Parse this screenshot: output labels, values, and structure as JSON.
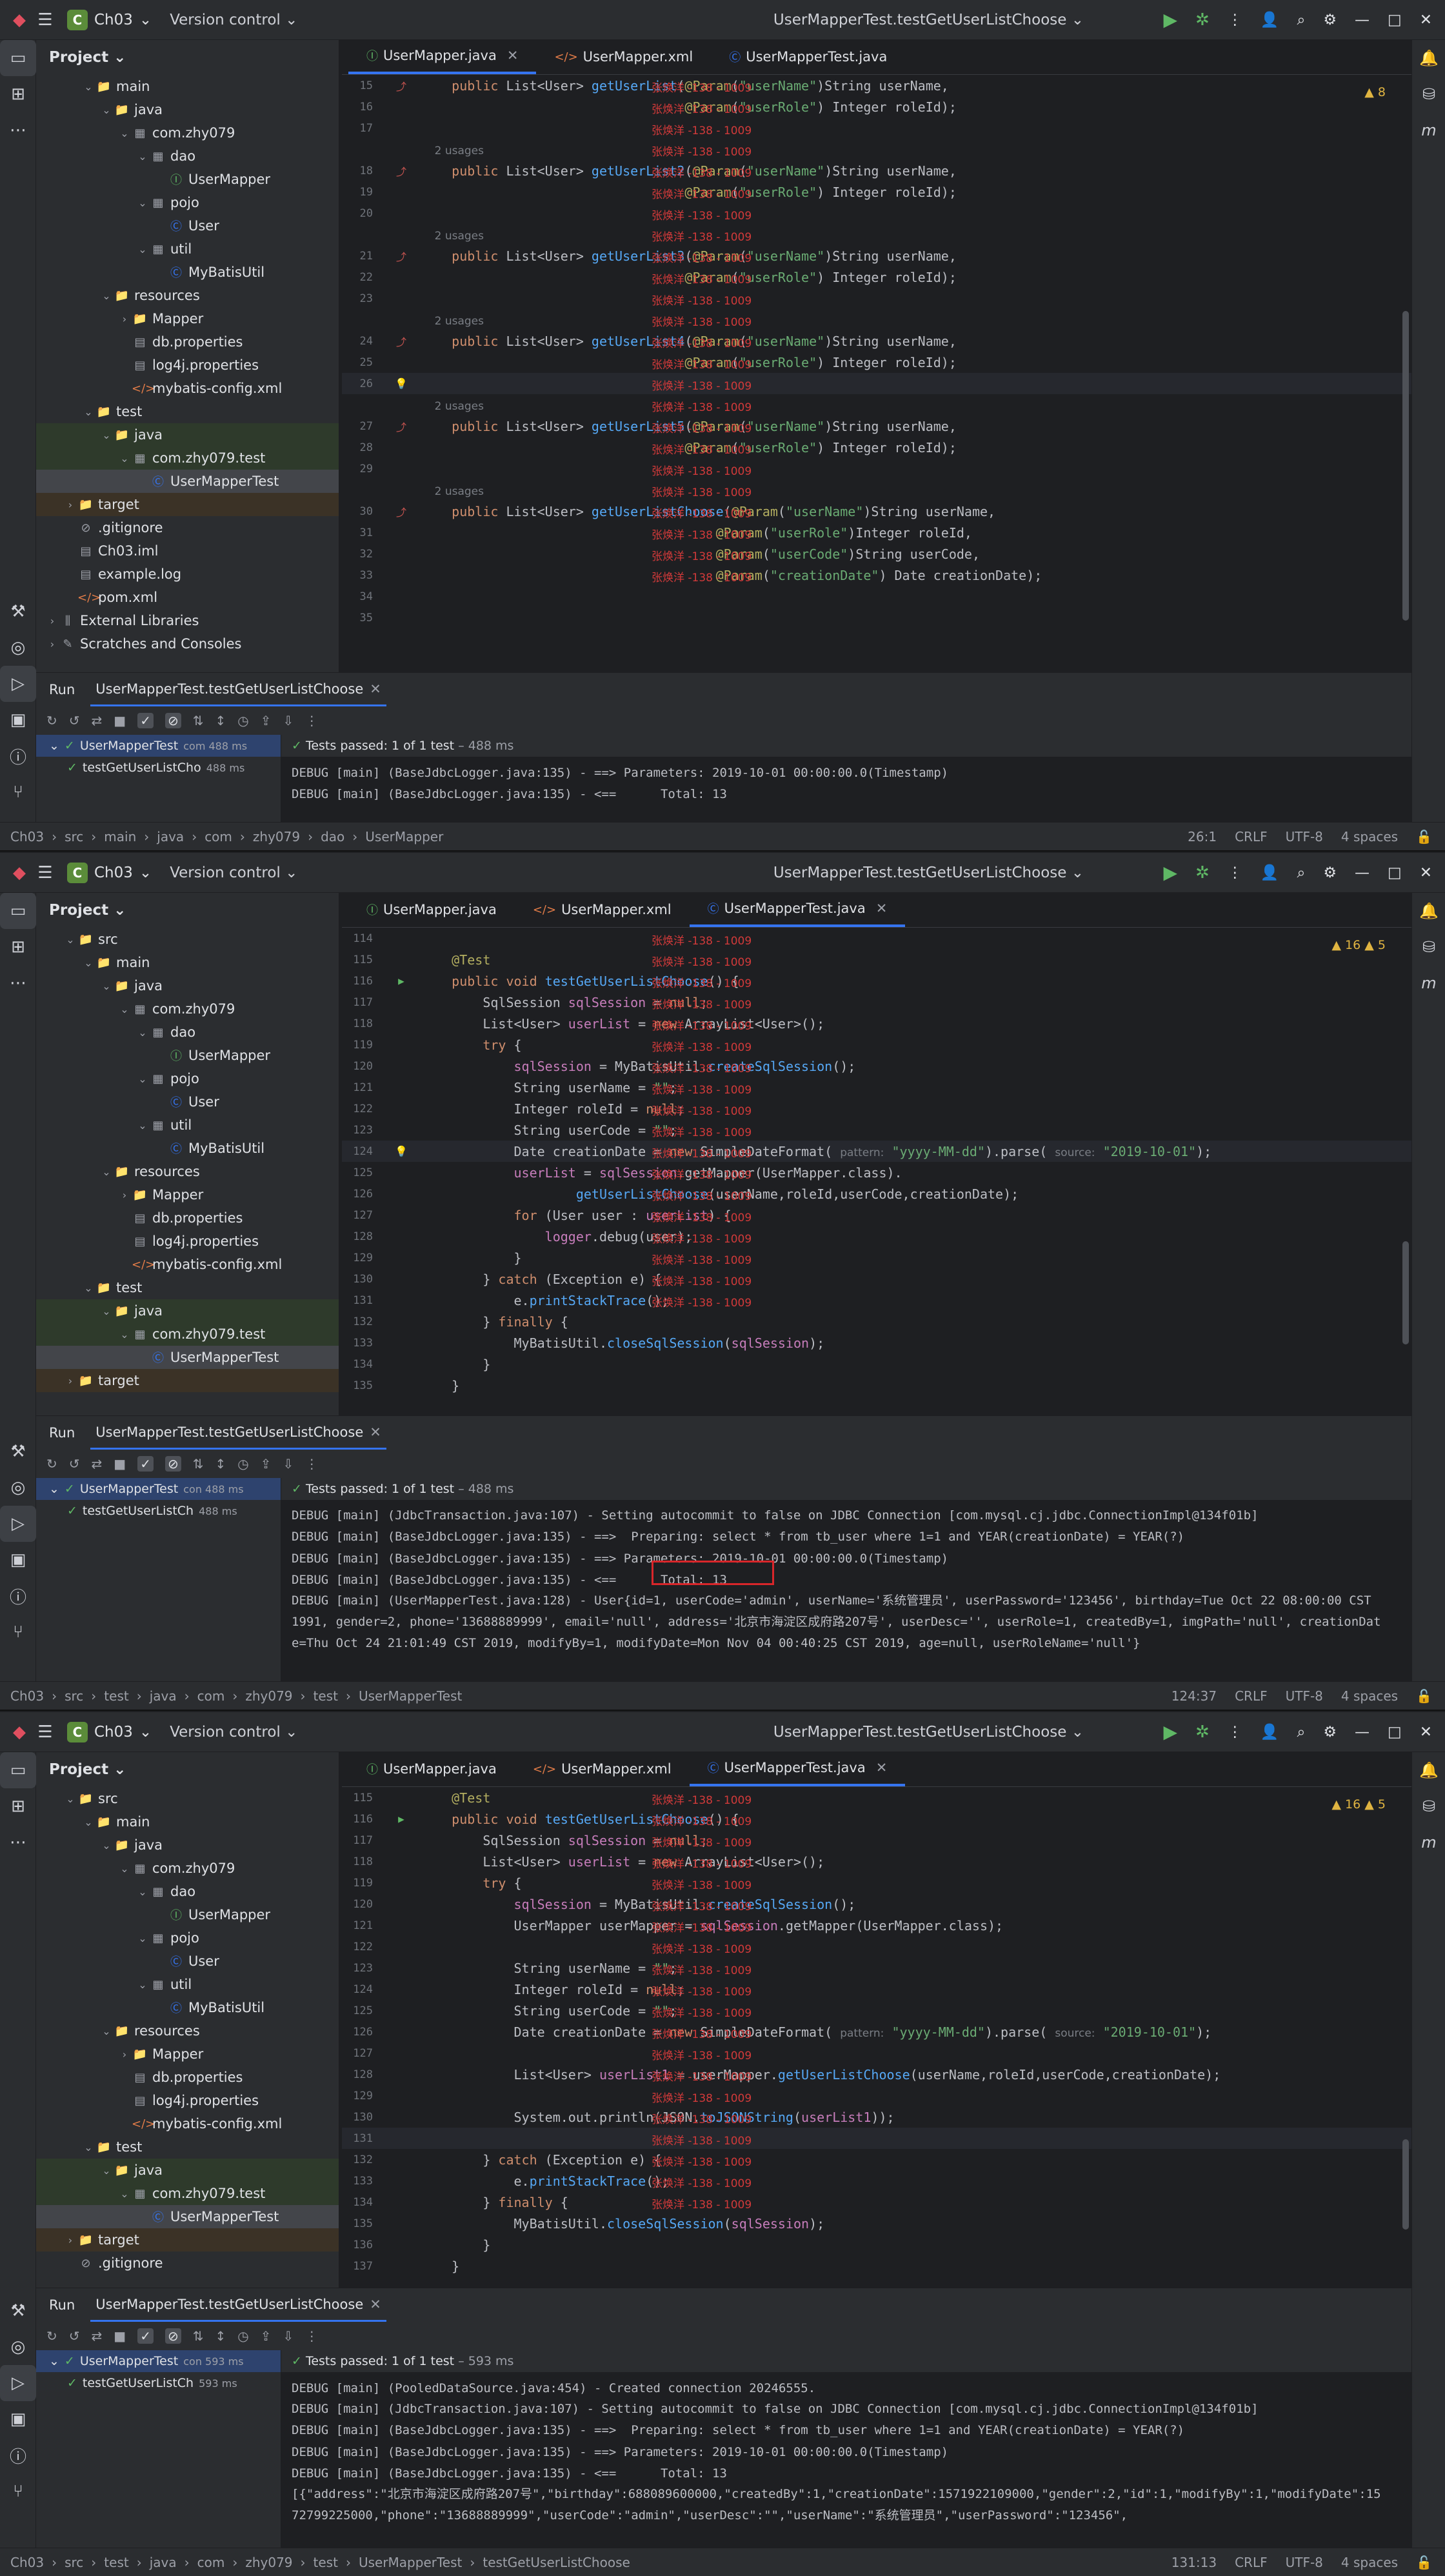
{
  "common": {
    "project_badge": "C",
    "project_name": "Ch03",
    "vcs": "Version control",
    "project_tool": "Project",
    "run_label": "Run",
    "tests_passed_label": "Tests passed:",
    "tests_passed_count": "1 of 1 test",
    "watermark": "张焕洋 -138 - 1009",
    "ide_icon": "ide-logo-icon",
    "colors": {
      "accent": "#3574f0",
      "green": "#5fb865",
      "keyword": "#cf8e6d",
      "function": "#56a8f5",
      "string": "#6aab73",
      "annotation": "#b3ae60"
    }
  },
  "p1": {
    "config": "UserMapperTest.testGetUserListChoose",
    "tabs": [
      {
        "label": "UserMapper.java"
      },
      {
        "label": "UserMapper.xml"
      },
      {
        "label": "UserMapperTest.java"
      }
    ],
    "inspection": "▲ 8",
    "tree": [
      "main",
      "java",
      "com.zhy079",
      "dao",
      "UserMapper",
      "pojo",
      "User",
      "util",
      "MyBatisUtil",
      "resources",
      "Mapper",
      "db.properties",
      "log4j.properties",
      "mybatis-config.xml",
      "test",
      "java",
      "com.zhy079.test",
      "UserMapperTest",
      "target",
      ".gitignore",
      "Ch03.iml",
      "example.log",
      "pom.xml",
      "External Libraries",
      "Scratches and Consoles"
    ],
    "lines": [
      {
        "n": "15",
        "c": "    public List<User> getUserList(@Param(\"userName\")String userName,"
      },
      {
        "n": "16",
        "c": "                                  @Param(\"userRole\") Integer roleId);"
      },
      {
        "n": "17",
        "c": ""
      },
      {
        "n": "",
        "c": "    2 usages"
      },
      {
        "n": "18",
        "c": "    public List<User> getUserList2(@Param(\"userName\")String userName,"
      },
      {
        "n": "19",
        "c": "                                  @Param(\"userRole\") Integer roleId);"
      },
      {
        "n": "20",
        "c": ""
      },
      {
        "n": "",
        "c": "    2 usages"
      },
      {
        "n": "21",
        "c": "    public List<User> getUserList3(@Param(\"userName\")String userName,"
      },
      {
        "n": "22",
        "c": "                                  @Param(\"userRole\") Integer roleId);"
      },
      {
        "n": "23",
        "c": ""
      },
      {
        "n": "",
        "c": "    2 usages"
      },
      {
        "n": "24",
        "c": "    public List<User> getUserList4(@Param(\"userName\")String userName,"
      },
      {
        "n": "25",
        "c": "                                  @Param(\"userRole\") Integer roleId);"
      },
      {
        "n": "26",
        "c": ""
      },
      {
        "n": "",
        "c": "    2 usages"
      },
      {
        "n": "27",
        "c": "    public List<User> getUserList5(@Param(\"userName\")String userName,"
      },
      {
        "n": "28",
        "c": "                                  @Param(\"userRole\") Integer roleId);"
      },
      {
        "n": "29",
        "c": ""
      },
      {
        "n": "",
        "c": "    2 usages"
      },
      {
        "n": "30",
        "c": "    public List<User> getUserListChoose(@Param(\"userName\")String userName,"
      },
      {
        "n": "31",
        "c": "                                      @Param(\"userRole\")Integer roleId,"
      },
      {
        "n": "32",
        "c": "                                      @Param(\"userCode\")String userCode,"
      },
      {
        "n": "33",
        "c": "                                      @Param(\"creationDate\") Date creationDate);"
      },
      {
        "n": "34",
        "c": ""
      },
      {
        "n": "35",
        "c": ""
      }
    ],
    "run_tab": "UserMapperTest.testGetUserListChoose",
    "run_tree": [
      {
        "label": "UserMapperTest",
        "meta": "com 488 ms"
      },
      {
        "label": "testGetUserListCho",
        "meta": "488 ms"
      }
    ],
    "duration": "488 ms",
    "console": [
      "DEBUG [main] (BaseJdbcLogger.java:135) - ==> Parameters: 2019-10-01 00:00:00.0(Timestamp)",
      "DEBUG [main] (BaseJdbcLogger.java:135) - <==      Total: 13"
    ],
    "breadcrumb": [
      "Ch03",
      "src",
      "main",
      "java",
      "com",
      "zhy079",
      "dao",
      "UserMapper"
    ],
    "status": [
      "26:1",
      "CRLF",
      "UTF-8",
      "4 spaces"
    ]
  },
  "p2": {
    "config": "UserMapperTest.testGetUserListChoose",
    "tabs": [
      {
        "label": "UserMapper.java"
      },
      {
        "label": "UserMapper.xml"
      },
      {
        "label": "UserMapperTest.java"
      }
    ],
    "inspection": "▲ 16  ▲ 5",
    "tree": [
      "src",
      "main",
      "java",
      "com.zhy079",
      "dao",
      "UserMapper",
      "pojo",
      "User",
      "util",
      "MyBatisUtil",
      "resources",
      "Mapper",
      "db.properties",
      "log4j.properties",
      "mybatis-config.xml",
      "test",
      "java",
      "com.zhy079.test",
      "UserMapperTest",
      "target"
    ],
    "lines": [
      {
        "n": "114",
        "c": ""
      },
      {
        "n": "115",
        "c": "    @Test"
      },
      {
        "n": "116",
        "c": "    public void testGetUserListChoose() {"
      },
      {
        "n": "117",
        "c": "        SqlSession sqlSession = null;"
      },
      {
        "n": "118",
        "c": "        List<User> userList = new ArrayList<User>();"
      },
      {
        "n": "119",
        "c": "        try {"
      },
      {
        "n": "120",
        "c": "            sqlSession = MyBatisUtil.createSqlSession();"
      },
      {
        "n": "121",
        "c": "            String userName = \"\";"
      },
      {
        "n": "122",
        "c": "            Integer roleId = null;"
      },
      {
        "n": "123",
        "c": "            String userCode = \"\";"
      },
      {
        "n": "124",
        "c": "            Date creationDate = new SimpleDateFormat( pattern: \"yyyy-MM-dd\").parse( source: \"2019-10-01\");"
      },
      {
        "n": "125",
        "c": "            userList = sqlSession.getMapper(UserMapper.class)."
      },
      {
        "n": "126",
        "c": "                    getUserListChoose(userName,roleId,userCode,creationDate);"
      },
      {
        "n": "127",
        "c": "            for (User user : userList) {"
      },
      {
        "n": "128",
        "c": "                logger.debug(user);"
      },
      {
        "n": "129",
        "c": "            }"
      },
      {
        "n": "130",
        "c": "        } catch (Exception e) {"
      },
      {
        "n": "131",
        "c": "            e.printStackTrace();"
      },
      {
        "n": "132",
        "c": "        } finally {"
      },
      {
        "n": "133",
        "c": "            MyBatisUtil.closeSqlSession(sqlSession);"
      },
      {
        "n": "134",
        "c": "        }"
      },
      {
        "n": "135",
        "c": "    }"
      }
    ],
    "run_tab": "UserMapperTest.testGetUserListChoose",
    "run_tree": [
      {
        "label": "UserMapperTest",
        "meta": "con 488 ms"
      },
      {
        "label": "testGetUserListCh",
        "meta": "488 ms"
      }
    ],
    "duration": "488 ms",
    "console": [
      "DEBUG [main] (JdbcTransaction.java:107) - Setting autocommit to false on JDBC Connection [com.mysql.cj.jdbc.ConnectionImpl@134f01b]",
      "DEBUG [main] (BaseJdbcLogger.java:135) - ==>  Preparing: select * from tb_user where 1=1 and YEAR(creationDate) = YEAR(?)",
      "DEBUG [main] (BaseJdbcLogger.java:135) - ==> Parameters: 2019-10-01 00:00:00.0(Timestamp)",
      "DEBUG [main] (BaseJdbcLogger.java:135) - <==      Total: 13",
      "DEBUG [main] (UserMapperTest.java:128) - User{id=1, userCode='admin', userName='系统管理员', userPassword='123456', birthday=Tue Oct 22 08:00:00 CST 1991, gender=2, phone='13688889999', email='null', address='北京市海淀区成府路207号', userDesc='', userRole=1, createdBy=1, imgPath='null', creationDate=Thu Oct 24 21:01:49 CST 2019, modifyBy=1, modifyDate=Mon Nov 04 00:40:25 CST 2019, age=null, userRoleName='null'}"
    ],
    "breadcrumb": [
      "Ch03",
      "src",
      "test",
      "java",
      "com",
      "zhy079",
      "test",
      "UserMapperTest"
    ],
    "status": [
      "124:37",
      "CRLF",
      "UTF-8",
      "4 spaces"
    ]
  },
  "p3": {
    "config": "UserMapperTest.testGetUserListChoose",
    "tabs": [
      {
        "label": "UserMapper.java"
      },
      {
        "label": "UserMapper.xml"
      },
      {
        "label": "UserMapperTest.java"
      }
    ],
    "inspection": "▲ 16  ▲ 5",
    "tree": [
      "src",
      "main",
      "java",
      "com.zhy079",
      "dao",
      "UserMapper",
      "pojo",
      "User",
      "util",
      "MyBatisUtil",
      "resources",
      "Mapper",
      "db.properties",
      "log4j.properties",
      "mybatis-config.xml",
      "test",
      "java",
      "com.zhy079.test",
      "UserMapperTest",
      "target",
      ".gitignore"
    ],
    "lines": [
      {
        "n": "115",
        "c": "    @Test"
      },
      {
        "n": "116",
        "c": "    public void testGetUserListChoose() {"
      },
      {
        "n": "117",
        "c": "        SqlSession sqlSession = null;"
      },
      {
        "n": "118",
        "c": "        List<User> userList = new ArrayList<User>();"
      },
      {
        "n": "119",
        "c": "        try {"
      },
      {
        "n": "120",
        "c": "            sqlSession = MyBatisUtil.createSqlSession();"
      },
      {
        "n": "121",
        "c": "            UserMapper userMapper = sqlSession.getMapper(UserMapper.class);"
      },
      {
        "n": "122",
        "c": ""
      },
      {
        "n": "123",
        "c": "            String userName = \"\";"
      },
      {
        "n": "124",
        "c": "            Integer roleId = null;"
      },
      {
        "n": "125",
        "c": "            String userCode = \"\";"
      },
      {
        "n": "126",
        "c": "            Date creationDate = new SimpleDateFormat( pattern: \"yyyy-MM-dd\").parse( source: \"2019-10-01\");"
      },
      {
        "n": "127",
        "c": ""
      },
      {
        "n": "128",
        "c": "            List<User> userList1 = userMapper.getUserListChoose(userName,roleId,userCode,creationDate);"
      },
      {
        "n": "129",
        "c": ""
      },
      {
        "n": "130",
        "c": "            System.out.println(JSON.toJSONString(userList1));"
      },
      {
        "n": "131",
        "c": ""
      },
      {
        "n": "132",
        "c": "        } catch (Exception e) {"
      },
      {
        "n": "133",
        "c": "            e.printStackTrace();"
      },
      {
        "n": "134",
        "c": "        } finally {"
      },
      {
        "n": "135",
        "c": "            MyBatisUtil.closeSqlSession(sqlSession);"
      },
      {
        "n": "136",
        "c": "        }"
      },
      {
        "n": "137",
        "c": "    }"
      }
    ],
    "run_tab": "UserMapperTest.testGetUserListChoose",
    "run_tree": [
      {
        "label": "UserMapperTest",
        "meta": "con 593 ms"
      },
      {
        "label": "testGetUserListCh",
        "meta": "593 ms"
      }
    ],
    "duration": "593 ms",
    "console": [
      "DEBUG [main] (PooledDataSource.java:454) - Created connection 20246555.",
      "DEBUG [main] (JdbcTransaction.java:107) - Setting autocommit to false on JDBC Connection [com.mysql.cj.jdbc.ConnectionImpl@134f01b]",
      "DEBUG [main] (BaseJdbcLogger.java:135) - ==>  Preparing: select * from tb_user where 1=1 and YEAR(creationDate) = YEAR(?)",
      "DEBUG [main] (BaseJdbcLogger.java:135) - ==> Parameters: 2019-10-01 00:00:00.0(Timestamp)",
      "DEBUG [main] (BaseJdbcLogger.java:135) - <==      Total: 13",
      "[{\"address\":\"北京市海淀区成府路207号\",\"birthday\":688089600000,\"createdBy\":1,\"creationDate\":1571922109000,\"gender\":2,\"id\":1,\"modifyBy\":1,\"modifyDate\":1572799225000,\"phone\":\"13688889999\",\"userCode\":\"admin\",\"userDesc\":\"\",\"userName\":\"系统管理员\",\"userPassword\":\"123456\","
    ],
    "breadcrumb": [
      "Ch03",
      "src",
      "test",
      "java",
      "com",
      "zhy079",
      "test",
      "UserMapperTest",
      "testGetUserListChoose"
    ],
    "status": [
      "131:13",
      "CRLF",
      "UTF-8",
      "4 spaces"
    ]
  }
}
